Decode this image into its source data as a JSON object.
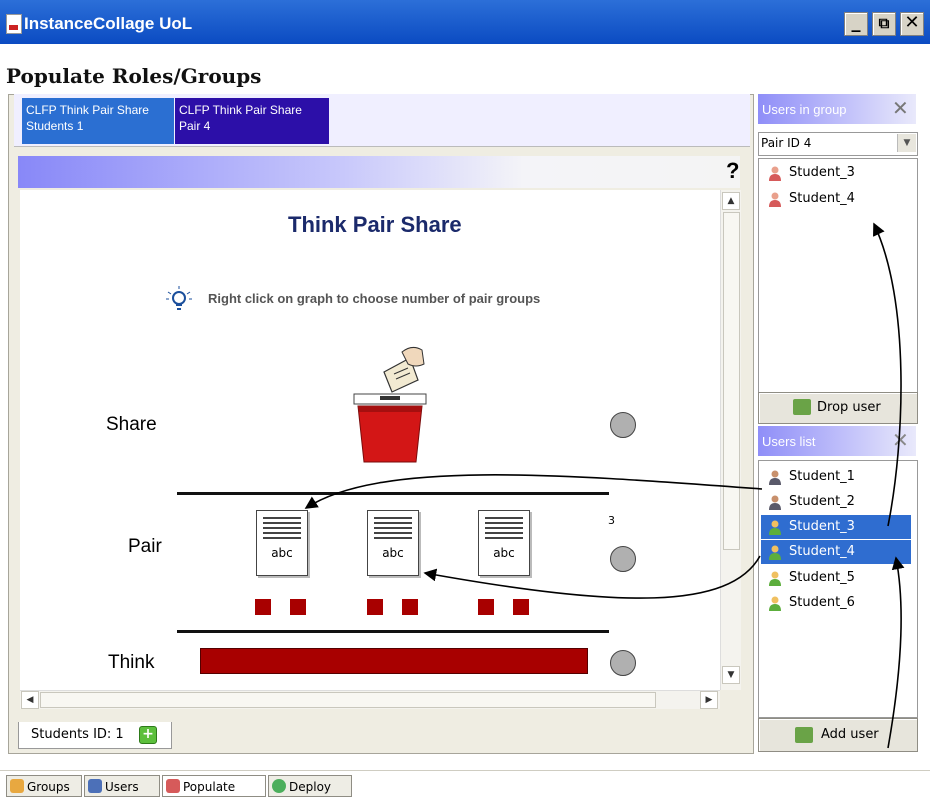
{
  "window": {
    "title": "InstanceCollage UoL"
  },
  "page": {
    "heading": "Populate Roles/Groups"
  },
  "role_tabs": [
    {
      "label": "CLFP Think Pair Share Students 1",
      "color": "#2b6fd2"
    },
    {
      "label": "CLFP Think Pair Share Pair 4",
      "color": "#2c0fa8"
    }
  ],
  "help": {
    "symbol": "?"
  },
  "canvas": {
    "title": "Think Pair Share",
    "hint": "Right click on graph to choose number of pair groups",
    "rows": {
      "share": "Share",
      "pair": "Pair",
      "think": "Think"
    },
    "pair_count": "3",
    "doc_label": "abc"
  },
  "bottom_tab": {
    "label": "Students ID: 1"
  },
  "users_in_group": {
    "title": "Users in group",
    "selected_group": "Pair ID 4",
    "users": [
      "Student_3",
      "Student_4"
    ],
    "drop_button": "Drop user"
  },
  "users_list": {
    "title": "Users list",
    "users": [
      {
        "name": "Student_1",
        "selected": false
      },
      {
        "name": "Student_2",
        "selected": false
      },
      {
        "name": "Student_3",
        "selected": true
      },
      {
        "name": "Student_4",
        "selected": true
      },
      {
        "name": "Student_5",
        "selected": false
      },
      {
        "name": "Student_6",
        "selected": false
      }
    ],
    "add_button": "Add user"
  },
  "toolbar": {
    "groups": "Groups",
    "users": "Users",
    "populate": "Populate",
    "deploy": "Deploy"
  },
  "colors": {
    "accent": "#0b4bc2",
    "selection": "#2f6dd0",
    "graph_red": "#a80000"
  }
}
